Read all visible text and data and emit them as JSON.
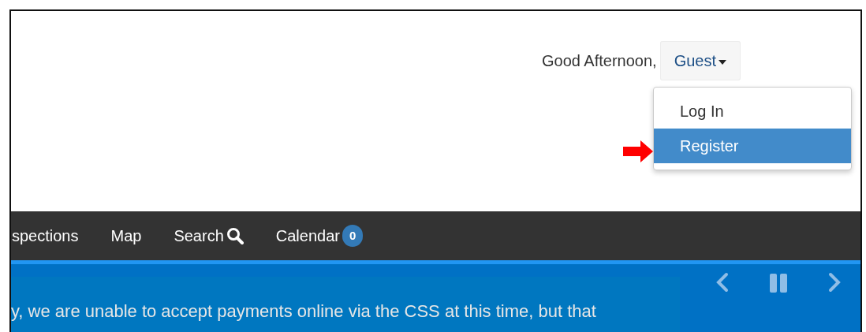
{
  "header": {
    "greeting": "Good Afternoon,",
    "user_menu": {
      "label": "Guest",
      "expanded": true,
      "items": [
        {
          "label": "Log In",
          "selected": false
        },
        {
          "label": "Register",
          "selected": true
        }
      ]
    }
  },
  "nav": {
    "items": [
      {
        "label": "spections",
        "kind": "link"
      },
      {
        "label": "Map",
        "kind": "link"
      },
      {
        "label": "Search",
        "kind": "search"
      },
      {
        "label": "Calendar",
        "kind": "badge",
        "badge": "0"
      }
    ]
  },
  "banner": {
    "message": "y, we are unable to accept payments online via the CSS at this time, but that"
  }
}
